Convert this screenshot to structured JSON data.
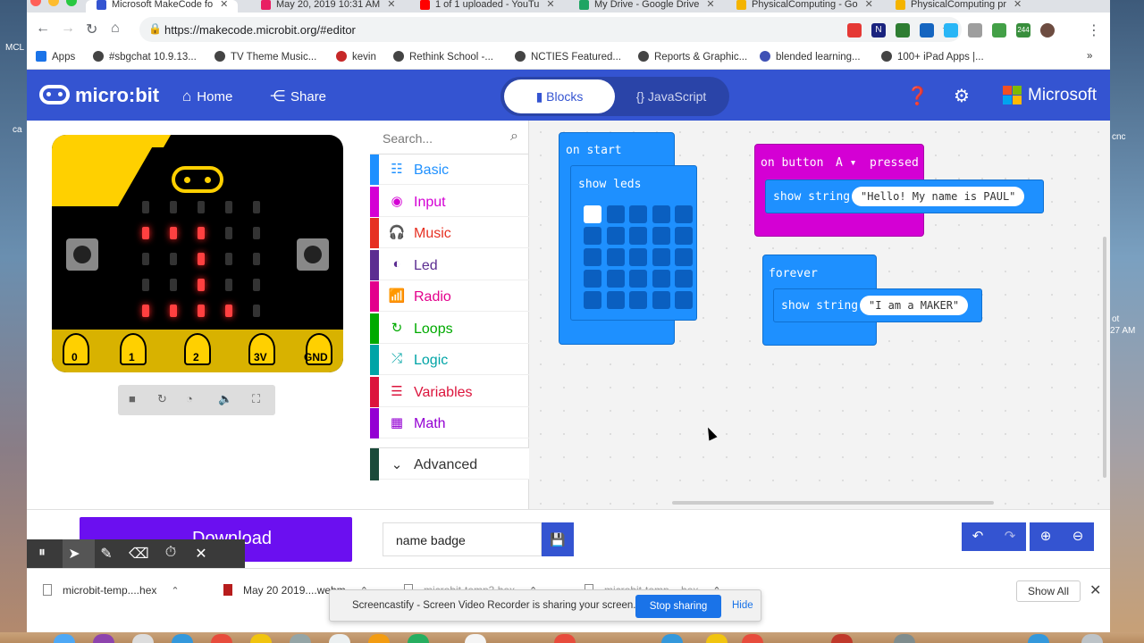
{
  "browser": {
    "tabs": [
      {
        "title": "Microsoft MakeCode fo",
        "active": true,
        "icon_color": "#3454d1"
      },
      {
        "title": "May 20, 2019 10:31 AM",
        "active": false,
        "icon_color": "#e91e63"
      },
      {
        "title": "1 of 1 uploaded - YouTu",
        "active": false,
        "icon_color": "#ff0000"
      },
      {
        "title": "My Drive - Google Drive",
        "active": false,
        "icon_color": "#1fa463"
      },
      {
        "title": "PhysicalComputing - Go",
        "active": false,
        "icon_color": "#f4b400"
      },
      {
        "title": "PhysicalComputing pr",
        "active": false,
        "icon_color": "#f4b400"
      }
    ],
    "url": "https://makecode.microbit.org/#editor",
    "bookmarks": [
      {
        "label": "Apps",
        "icon": "grid-icon"
      },
      {
        "label": "#sbgchat 10.9.13...",
        "icon": "globe-icon"
      },
      {
        "label": "TV Theme Music...",
        "icon": "globe-icon"
      },
      {
        "label": "kevin",
        "icon": "target-icon"
      },
      {
        "label": "Rethink School -...",
        "icon": "globe-icon"
      },
      {
        "label": "NCTIES Featured...",
        "icon": "globe-icon"
      },
      {
        "label": "Reports & Graphic...",
        "icon": "globe-icon"
      },
      {
        "label": "blended learning...",
        "icon": "wifi-icon"
      },
      {
        "label": "100+ iPad Apps |...",
        "icon": "globe-icon"
      }
    ],
    "extension_badge": "244"
  },
  "header": {
    "logo": "micro:bit",
    "home_label": "Home",
    "share_label": "Share",
    "blocks_label": "Blocks",
    "javascript_label": "{} JavaScript",
    "microsoft_label": "Microsoft",
    "accent_color": "#3454d1"
  },
  "simulator": {
    "button_a": "A",
    "button_b": "B",
    "pins": [
      "0",
      "1",
      "2",
      "3V",
      "GND"
    ],
    "led_matrix": [
      [
        0,
        0,
        0,
        0,
        0
      ],
      [
        1,
        1,
        1,
        0,
        0
      ],
      [
        0,
        0,
        1,
        0,
        0
      ],
      [
        0,
        0,
        1,
        0,
        0
      ],
      [
        1,
        1,
        1,
        1,
        0
      ]
    ]
  },
  "toolbox": {
    "search_placeholder": "Search...",
    "categories": [
      {
        "label": "Basic",
        "color": "#1e90ff",
        "icon": "grid-icon"
      },
      {
        "label": "Input",
        "color": "#d400d4",
        "icon": "target-icon"
      },
      {
        "label": "Music",
        "color": "#e63022",
        "icon": "headphones-icon"
      },
      {
        "label": "Led",
        "color": "#5c2d91",
        "icon": "toggle-icon"
      },
      {
        "label": "Radio",
        "color": "#e3008c",
        "icon": "signal-icon"
      },
      {
        "label": "Loops",
        "color": "#00aa00",
        "icon": "refresh-icon"
      },
      {
        "label": "Logic",
        "color": "#00a4a6",
        "icon": "shuffle-icon"
      },
      {
        "label": "Variables",
        "color": "#dc143c",
        "icon": "list-icon"
      },
      {
        "label": "Math",
        "color": "#9400d3",
        "icon": "calculator-icon"
      }
    ],
    "advanced_label": "Advanced"
  },
  "workspace": {
    "on_start": {
      "label": "on start",
      "show_leds": "show leds",
      "leds": [
        [
          1,
          0,
          0,
          0,
          0
        ],
        [
          0,
          0,
          0,
          0,
          0
        ],
        [
          0,
          0,
          0,
          0,
          0
        ],
        [
          0,
          0,
          0,
          0,
          0
        ],
        [
          0,
          0,
          0,
          0,
          0
        ]
      ]
    },
    "on_button": {
      "prefix": "on button",
      "button": "A",
      "suffix": "pressed",
      "show_string": "show string",
      "value": "\"Hello! My name is PAUL\""
    },
    "forever": {
      "label": "forever",
      "show_string": "show string",
      "value": "\"I am a MAKER\""
    }
  },
  "bottom": {
    "download_label": "Download",
    "project_name": "name badge"
  },
  "downloads": [
    {
      "name": "microbit-temp....hex"
    },
    {
      "name": "May 20 2019....webm"
    },
    {
      "name": "microbit-temp3.hex"
    },
    {
      "name": "microbit-temp....hex"
    }
  ],
  "shelf": {
    "show_all": "Show All"
  },
  "notice": {
    "text": "Screencastify - Screen Video Recorder is sharing your screen.",
    "stop_label": "Stop sharing",
    "hide_label": "Hide"
  },
  "desktop": {
    "left_label_1": "MCL",
    "left_label_2": "ca",
    "right_label_1": "ot",
    "right_label_2": "27 AM",
    "right_label_3": "cnc"
  }
}
